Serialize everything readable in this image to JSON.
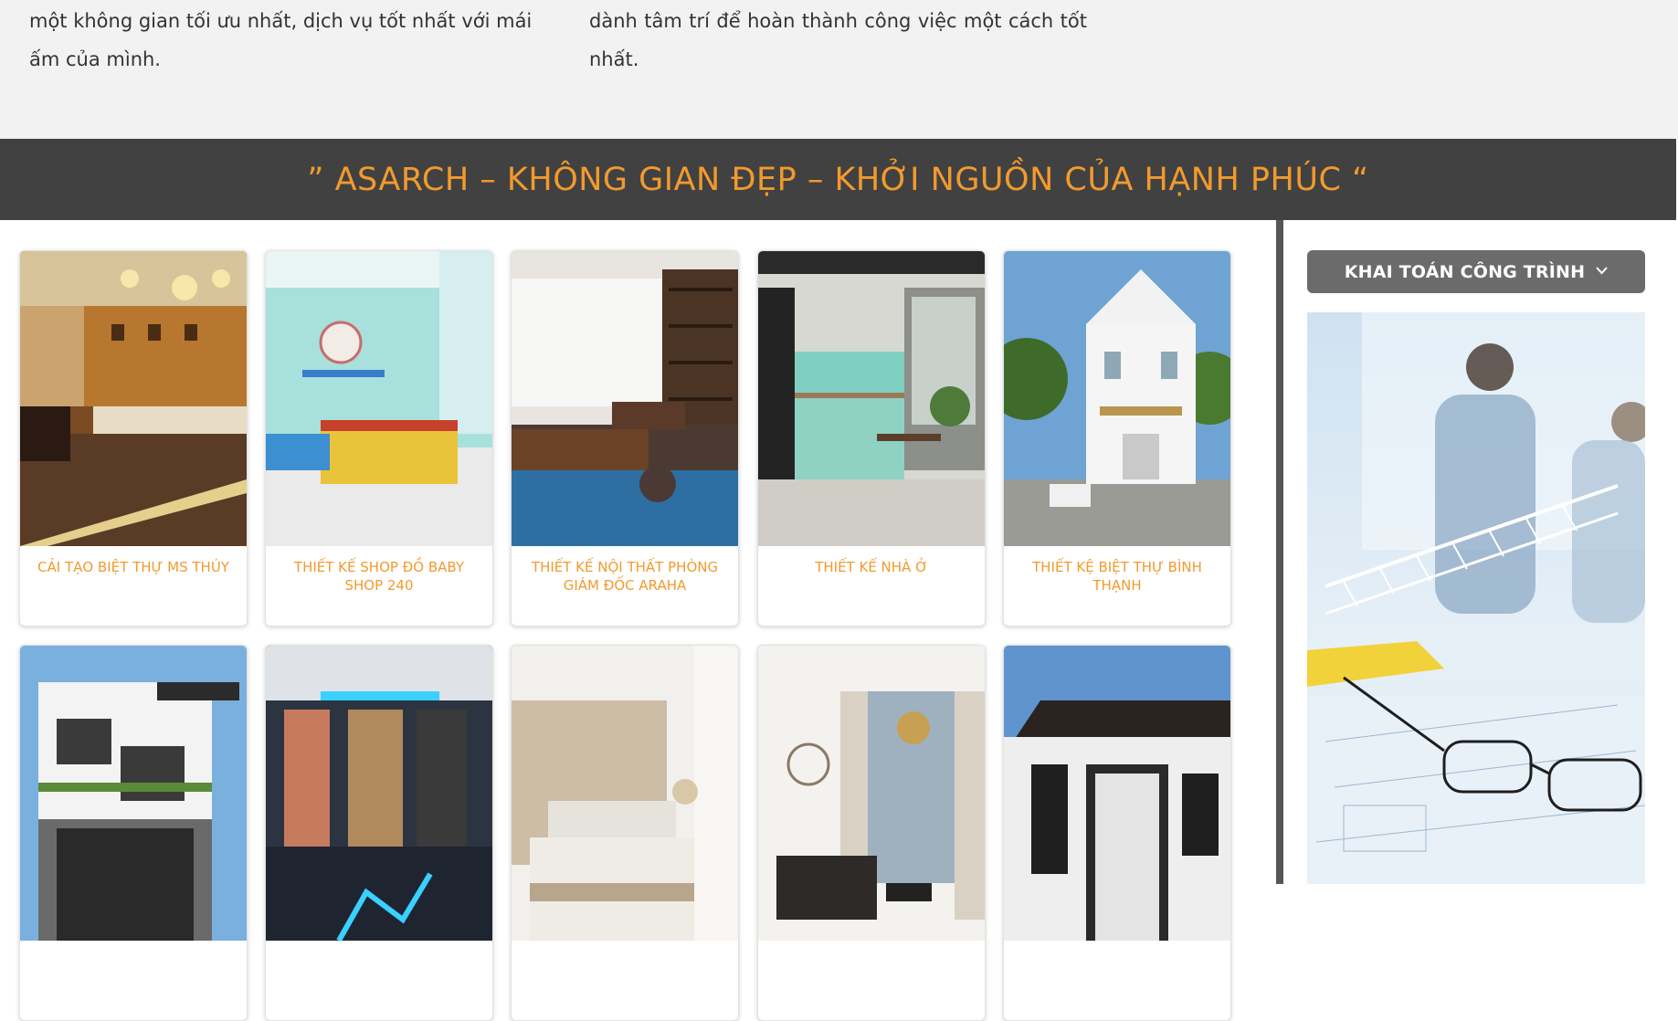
{
  "intro": {
    "col1": "một không gian tối ưu nhất, dịch vụ tốt nhất với mái ấm của mình.",
    "col2": "dành tâm trí để hoàn thành công việc một cách tốt nhất."
  },
  "banner": {
    "title": "” ASARCH – KHÔNG GIAN ĐẸP – KHỞI NGUỒN CỦA HẠNH PHÚC “"
  },
  "projects": [
    {
      "title": "CẢI TẠO BIỆT THỰ MS THÚY",
      "image": "villa-renovation-interior"
    },
    {
      "title": "THIẾT KẾ SHOP ĐỒ BABY SHOP 240",
      "image": "baby-shop-interior"
    },
    {
      "title": "THIẾT KẾ NỘI THẤT PHÒNG GIÁM ĐỐC ARAHA",
      "image": "director-office-interior"
    },
    {
      "title": "THIẾT KẾ NHÀ Ở",
      "image": "kitchen-interior"
    },
    {
      "title": "THIẾT KỆ BIỆT THỰ BÌNH THẠNH",
      "image": "white-villa-exterior"
    },
    {
      "title": "",
      "image": "townhouse-exterior"
    },
    {
      "title": "",
      "image": "showroom-interior"
    },
    {
      "title": "",
      "image": "bedroom-interior"
    },
    {
      "title": "",
      "image": "living-room-interior"
    },
    {
      "title": "",
      "image": "house-facade-exterior"
    }
  ],
  "sidebar": {
    "button_label": "KHAI TOÁN CÔNG TRÌNH",
    "button_icon": "chevron-down-icon",
    "image": "engineers-blueprint-photo"
  },
  "colors": {
    "accent": "#f29a2e",
    "banner_bg": "#414141",
    "button_bg": "#6b6b6b",
    "intro_bg": "#f2f2f2"
  }
}
